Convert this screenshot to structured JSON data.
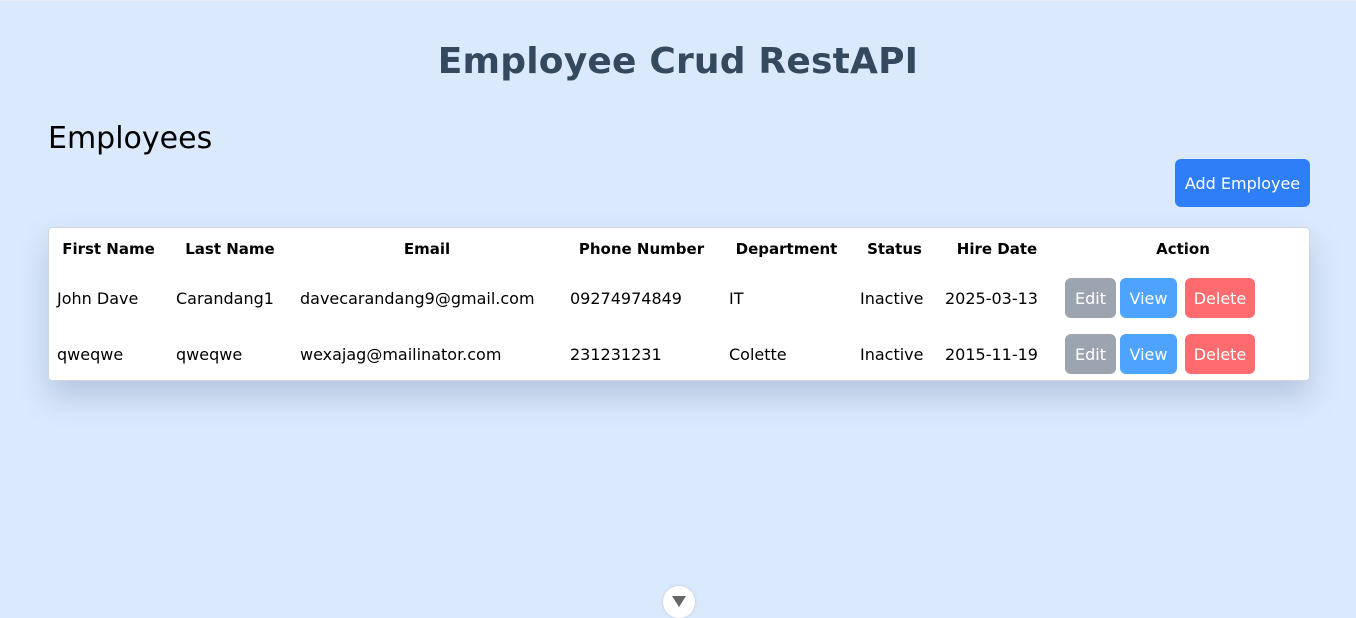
{
  "app": {
    "title": "Employee Crud RestAPI"
  },
  "section": {
    "title": "Employees"
  },
  "toolbar": {
    "add_label": "Add Employee"
  },
  "table": {
    "columns": [
      "First Name",
      "Last Name",
      "Email",
      "Phone Number",
      "Department",
      "Status",
      "Hire Date",
      "Action"
    ],
    "rows": [
      {
        "first_name": "John Dave",
        "last_name": "Carandang1",
        "email": "davecarandang9@gmail.com",
        "phone": "09274974849",
        "department": "IT",
        "status": "Inactive",
        "hire_date": "2025-03-13"
      },
      {
        "first_name": "qweqwe",
        "last_name": "qweqwe",
        "email": "wexajag@mailinator.com",
        "phone": "231231231",
        "department": "Colette",
        "status": "Inactive",
        "hire_date": "2015-11-19"
      }
    ],
    "actions": {
      "edit": "Edit",
      "view": "View",
      "delete": "Delete"
    }
  },
  "colors": {
    "background": "#dbe9fd",
    "title": "#34495e",
    "primary": "#2e7ff7",
    "edit": "#9ca4b0",
    "view": "#4da3ff",
    "delete": "#ff6b6f"
  },
  "icons": {
    "scroll_handle": "chevron-down-icon"
  }
}
